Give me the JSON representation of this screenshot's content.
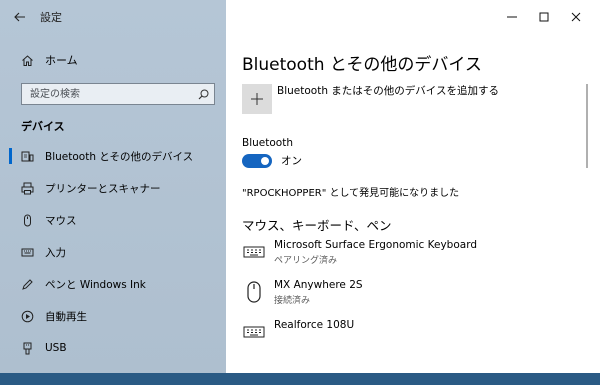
{
  "window": {
    "app_title": "設定"
  },
  "sidebar": {
    "home_label": "ホーム",
    "search_placeholder": "設定の検索",
    "section_heading": "デバイス",
    "items": [
      {
        "label": "Bluetooth とその他のデバイス",
        "icon": "bluetooth-devices-icon",
        "active": true
      },
      {
        "label": "プリンターとスキャナー",
        "icon": "printer-icon",
        "active": false
      },
      {
        "label": "マウス",
        "icon": "mouse-icon",
        "active": false
      },
      {
        "label": "入力",
        "icon": "keyboard-icon",
        "active": false
      },
      {
        "label": "ペンと Windows Ink",
        "icon": "pen-icon",
        "active": false
      },
      {
        "label": "自動再生",
        "icon": "autoplay-icon",
        "active": false
      },
      {
        "label": "USB",
        "icon": "usb-icon",
        "active": false
      }
    ]
  },
  "main": {
    "page_title": "Bluetooth とその他のデバイス",
    "add_device_label": "Bluetooth またはその他のデバイスを追加する",
    "bluetooth_label": "Bluetooth",
    "bluetooth_state": "オン",
    "discoverable_text": "\"RPOCKHOPPER\" として発見可能になりました",
    "group_heading": "マウス、キーボード、ペン",
    "devices": [
      {
        "name": "Microsoft Surface Ergonomic Keyboard",
        "status": "ペアリング済み",
        "icon": "keyboard-icon"
      },
      {
        "name": "MX Anywhere 2S",
        "status": "接続済み",
        "icon": "mouse-icon"
      },
      {
        "name": "Realforce 108U",
        "status": "",
        "icon": "keyboard-icon"
      }
    ]
  },
  "colors": {
    "accent": "#1565c0",
    "sidebar_bg": "#b0c2d3",
    "active_indicator": "#0066cc"
  }
}
